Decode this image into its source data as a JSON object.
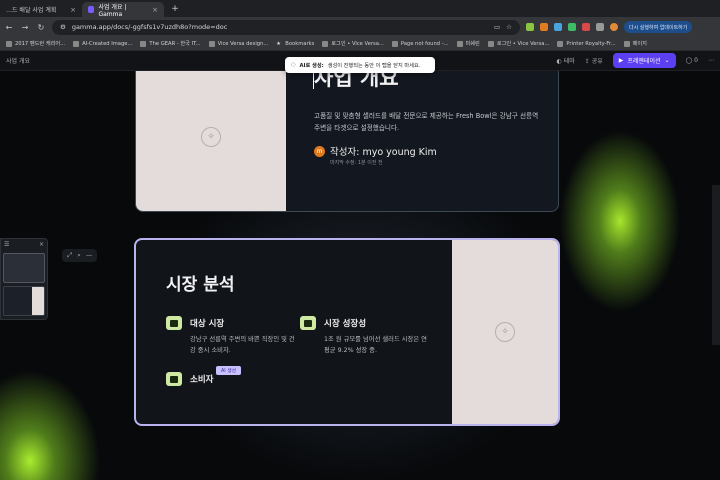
{
  "browser": {
    "tabs": [
      {
        "label": "…드 배달 사업 계획"
      },
      {
        "label": "사업 개요 | Gamma"
      }
    ],
    "url": "gamma.app/docs/-ggfsfs1v7uzdh8o?mode=doc",
    "update_label": "다시 실행하여 업데이트하기",
    "bookmarks": [
      "2017 펜드런 캐리어...",
      "AI-Created Image...",
      "The GEAR - 한국 IT...",
      "Vice Versa design...",
      "Bookmarks",
      "로그인 • Vice Versa...",
      "Page not found -...",
      "미쉐린",
      "로그인 • Vice Versa...",
      "Printer Royalty-Fr...",
      "페이지"
    ]
  },
  "app": {
    "doc_title": "사업 개요",
    "theme_label": "테마",
    "share_label": "공유",
    "present_label": "프레젠테이션",
    "comment_count": "0"
  },
  "toast": {
    "title": "AI로 생성:",
    "message": "생성이 진행되는 동안 이 탭을 닫지 마세요."
  },
  "card1": {
    "heading": "사업 개요",
    "description": "고품질 및 맞춤형 샐러드를 배달 전문으로 제공하는 Fresh Bowl은 강남구 선릉역 주변을 타겟으로 설정했습니다.",
    "author_initial": "m",
    "author_name": "작성자: myo young Kim",
    "author_sub": "마지막 수정: 1분 이전 전"
  },
  "card2": {
    "heading": "시장 분석",
    "features": [
      {
        "title": "대상 시장",
        "desc": "강남구 선릉역 주변의 바쁜 직장인 및 건강 중시 소비자."
      },
      {
        "title": "시장 성장성",
        "desc": "1조 원 규모를 넘어선 샐러드 시장은 연평균 9.2% 성장 중."
      },
      {
        "title": "소비자",
        "desc": ""
      }
    ],
    "ai_tag": "AI 생성"
  },
  "colors": {
    "accent": "#5b3ff0",
    "glow": "#a6e62c",
    "card_border_active": "#b9b3ee"
  }
}
